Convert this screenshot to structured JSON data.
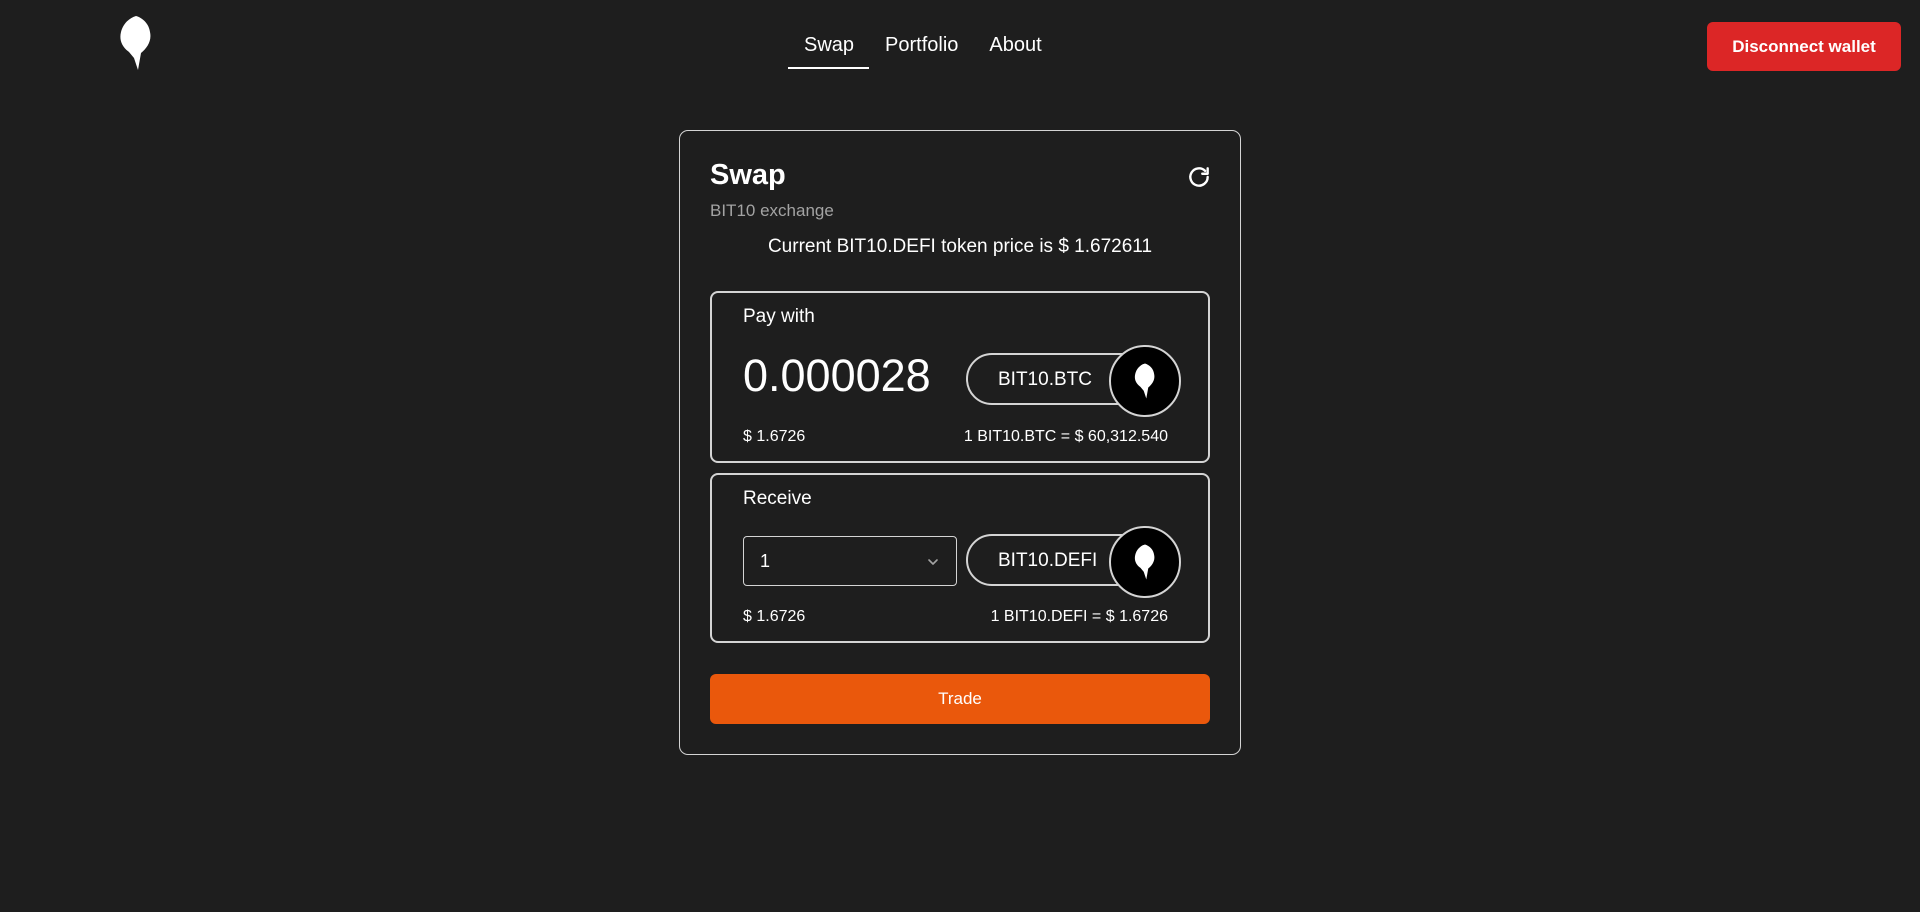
{
  "nav": {
    "items": [
      {
        "label": "Swap",
        "active": true
      },
      {
        "label": "Portfolio",
        "active": false
      },
      {
        "label": "About",
        "active": false
      }
    ],
    "disconnect_label": "Disconnect wallet"
  },
  "swap": {
    "title": "Swap",
    "subtitle": "BIT10 exchange",
    "price_text": "Current BIT10.DEFI token price is $ 1.672611",
    "pay": {
      "label": "Pay with",
      "amount": "0.000028",
      "token": "BIT10.BTC",
      "usd_value": "$ 1.6726",
      "rate": "1 BIT10.BTC = $ 60,312.540"
    },
    "receive": {
      "label": "Receive",
      "quantity": "1",
      "token": "BIT10.DEFI",
      "usd_value": "$ 1.6726",
      "rate": "1 BIT10.DEFI = $ 1.6726"
    },
    "trade_label": "Trade"
  },
  "colors": {
    "background": "#1e1e1e",
    "disconnect": "#dc2626",
    "trade": "#ea580c",
    "border": "#d4d4d4"
  },
  "icons": [
    "logo-icon",
    "refresh-icon",
    "token-icon",
    "chevron-down-icon"
  ]
}
